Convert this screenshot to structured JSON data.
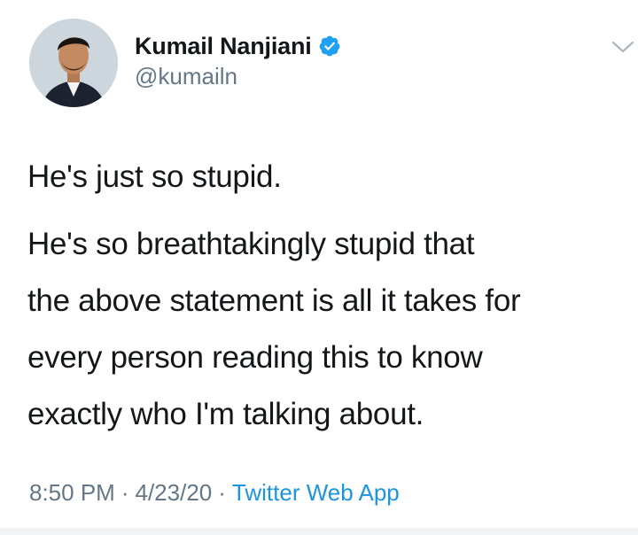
{
  "tweet": {
    "author": {
      "display_name": "Kumail Nanjiani",
      "handle": "@kumailn",
      "verified_icon": "verified-badge-icon",
      "avatar_icon": "profile-photo"
    },
    "menu_icon": "chevron-down-icon",
    "text_paragraphs": [
      "He's just so stupid.",
      "He's so breathtakingly stupid that\nthe above statement is all it takes for\nevery person reading this to know\nexactly who I'm talking about."
    ],
    "meta": {
      "time": "8:50 PM",
      "separator": "·",
      "date": "4/23/20",
      "source": "Twitter Web App"
    }
  },
  "colors": {
    "text_primary": "#14171a",
    "text_secondary": "#657786",
    "accent_blue": "#1b95e0",
    "background": "#ffffff"
  }
}
